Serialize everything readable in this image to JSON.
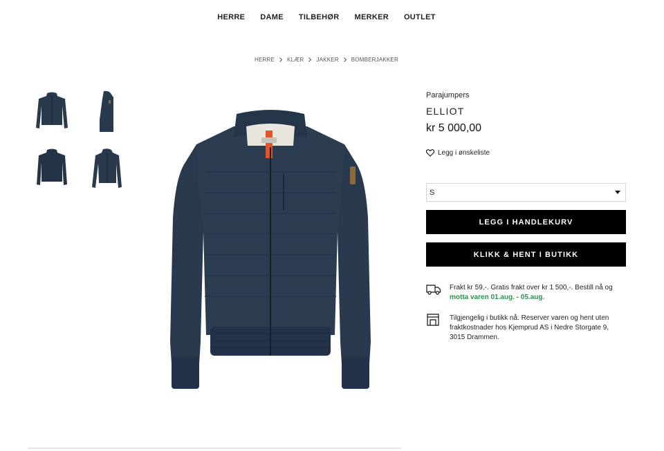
{
  "nav": {
    "items": [
      {
        "label": "HERRE"
      },
      {
        "label": "DAME"
      },
      {
        "label": "TILBEHØR"
      },
      {
        "label": "MERKER"
      },
      {
        "label": "OUTLET"
      }
    ]
  },
  "breadcrumb": [
    "HERRE",
    "KLÆR",
    "JAKKER",
    "BOMBERJAKKER"
  ],
  "product": {
    "brand": "Parajumpers",
    "name": "ELLIOT",
    "price": "kr 5 000,00",
    "wishlist_label": "Legg i ønskeliste",
    "size_selected": "S",
    "add_to_cart_label": "LEGG I HANDLEKURV",
    "click_collect_label": "KLIKK & HENT I BUTIKK"
  },
  "shipping": {
    "text": "Frakt kr 59,-. Gratis frakt over kr 1 500,-. Bestill nå og",
    "highlight": "motta varen 01.aug. - 05.aug."
  },
  "store_info": {
    "text": "Tilgjengelig i butikk nå. Reserver varen og hent uten fraktkostnader hos Kjemprud AS i Nedre Storgate 9, 3015 Drammen."
  },
  "colors": {
    "jacket": "#2a3a4d",
    "button": "#000000",
    "delivery_green": "#2e8f54"
  }
}
